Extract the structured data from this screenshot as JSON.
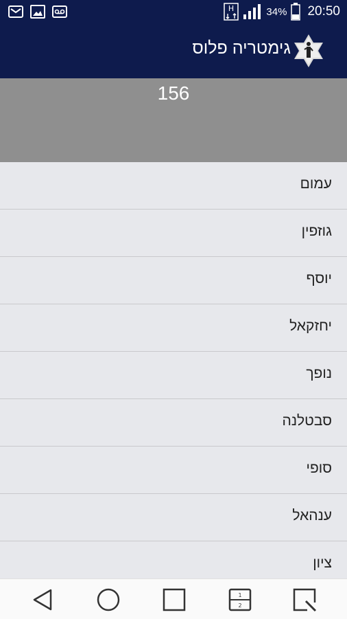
{
  "status": {
    "battery": "34%",
    "time": "20:50",
    "icons": [
      "mail-icon",
      "image-icon",
      "voicemail-icon",
      "hplus-icon",
      "signal-icon",
      "battery-icon"
    ]
  },
  "app": {
    "title": "גימטריה פלוס",
    "logo": "star-of-david-logo"
  },
  "result": {
    "value": "156"
  },
  "list": {
    "items": [
      {
        "label": "עמום"
      },
      {
        "label": "גוזפין"
      },
      {
        "label": "יוסף"
      },
      {
        "label": "יחזקאל"
      },
      {
        "label": "נופך"
      },
      {
        "label": "סבטלנה"
      },
      {
        "label": "סופי"
      },
      {
        "label": "ענהאל"
      },
      {
        "label": "ציון"
      }
    ]
  },
  "nav": {
    "icons": [
      "back-icon",
      "home-icon",
      "recents-icon",
      "dual-window-icon",
      "capture-icon"
    ]
  },
  "colors": {
    "bar": "#0e1b4d",
    "result_bg": "#8f8f8f",
    "list_bg": "#e7e8ec"
  }
}
